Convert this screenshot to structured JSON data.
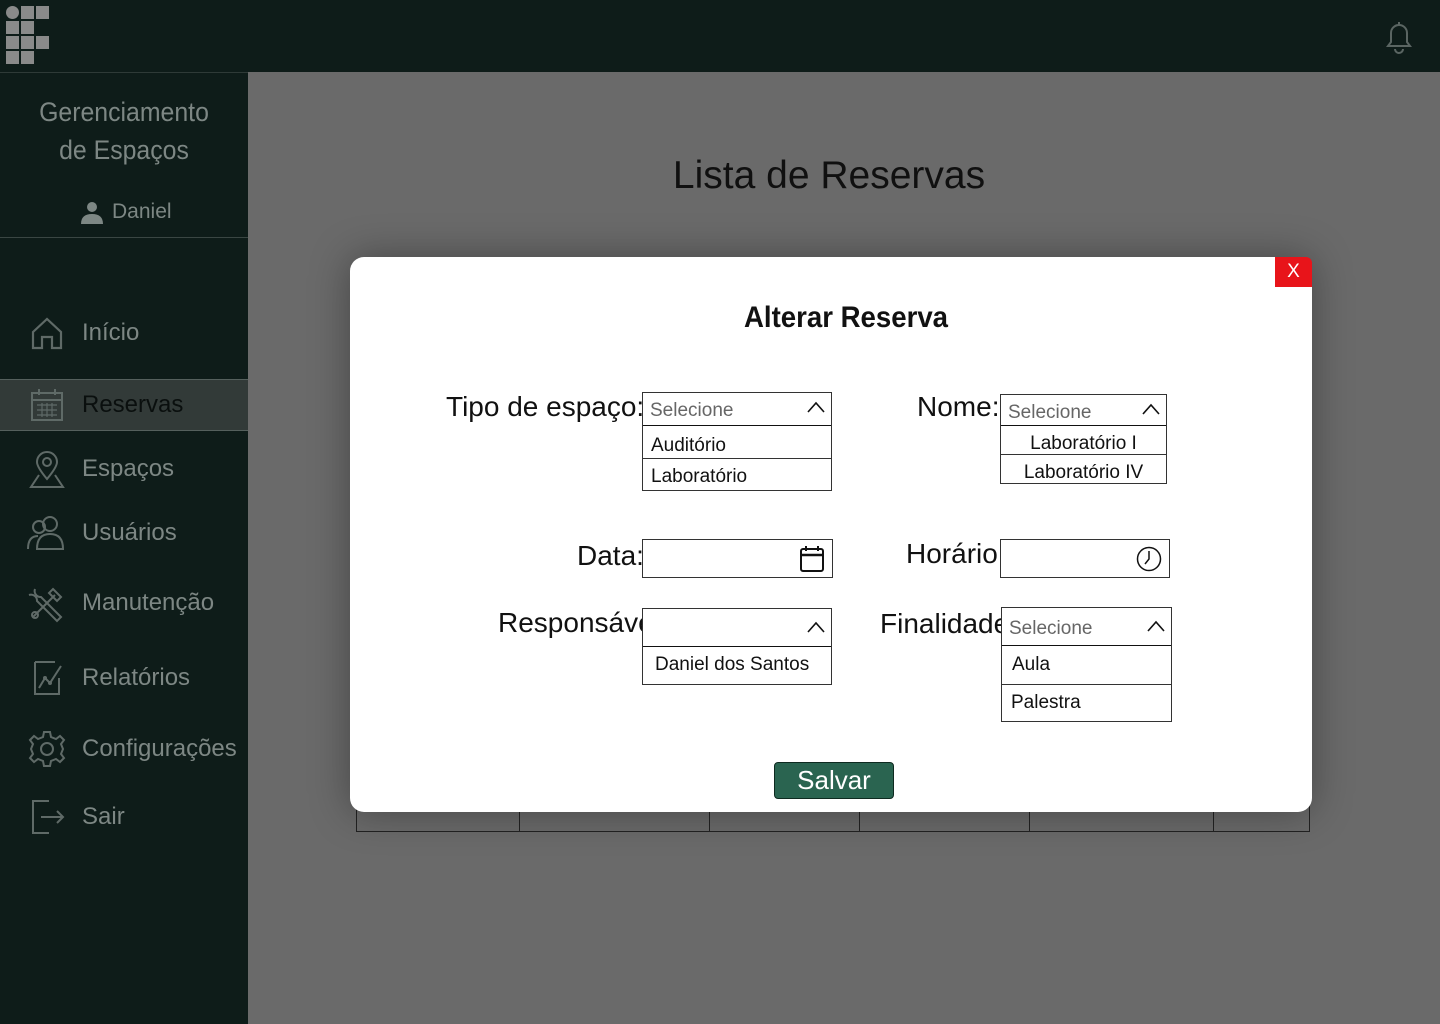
{
  "header": {
    "logo_icon": "institution-logo-icon",
    "notification_icon": "bell-icon"
  },
  "sidebar": {
    "brand_line1": "Gerenciamento",
    "brand_line2": "de Espaços",
    "user_name": "Daniel",
    "items": [
      {
        "label": "Início",
        "icon": "home-icon"
      },
      {
        "label": "Reservas",
        "icon": "calendar-icon",
        "active": true
      },
      {
        "label": "Espaços",
        "icon": "location-pin-icon"
      },
      {
        "label": "Usuários",
        "icon": "users-icon"
      },
      {
        "label": "Manutenção",
        "icon": "tools-icon"
      },
      {
        "label": "Relatórios",
        "icon": "report-chart-icon"
      },
      {
        "label": "Configurações",
        "icon": "gear-icon"
      },
      {
        "label": "Sair",
        "icon": "logout-icon"
      }
    ]
  },
  "main": {
    "title": "Lista de Reservas"
  },
  "modal": {
    "close_label": "X",
    "title": "Alterar Reserva",
    "tipo": {
      "label": "Tipo de espaço:",
      "placeholder": "Selecione",
      "options": [
        "Auditório",
        "Laboratório"
      ]
    },
    "nome": {
      "label": "Nome:",
      "placeholder": "Selecione",
      "options": [
        "Laboratório I",
        "Laboratório IV"
      ]
    },
    "data": {
      "label": "Data:",
      "value": ""
    },
    "horario": {
      "label": "Horário:",
      "value": ""
    },
    "responsavel": {
      "label": "Responsável:",
      "value": "",
      "options": [
        "Daniel dos Santos"
      ]
    },
    "finalidade": {
      "label": "Finalidade:",
      "placeholder": "Selecione",
      "options": [
        "Aula",
        "Palestra"
      ]
    },
    "save_label": "Salvar"
  },
  "colors": {
    "sidebar_bg": "#0e1c19",
    "overlay_bg": "#6a6a6a",
    "save_button": "#2a6450",
    "close_button": "#e8141a"
  }
}
